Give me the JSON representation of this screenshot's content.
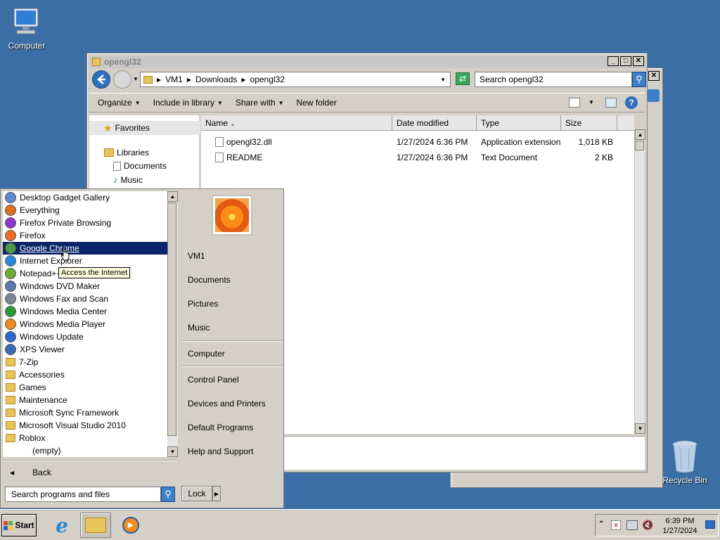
{
  "desktop": {
    "computer_label": "Computer",
    "recycle_label": "Recycle Bin"
  },
  "explorer": {
    "title": "opengl32",
    "breadcrumb": [
      "VM1",
      "Downloads",
      "opengl32"
    ],
    "search_placeholder": "Search opengl32",
    "commands": {
      "organize": "Organize",
      "include": "Include in library",
      "share": "Share with",
      "new_folder": "New folder"
    },
    "nav": {
      "favorites": "Favorites",
      "libraries": "Libraries",
      "documents": "Documents",
      "music": "Music"
    },
    "columns": [
      "Name",
      "Date modified",
      "Type",
      "Size"
    ],
    "files": [
      {
        "name": "opengl32.dll",
        "date": "1/27/2024 6:36 PM",
        "type": "Application extension",
        "size": "1,018 KB"
      },
      {
        "name": "README",
        "date": "1/27/2024 6:36 PM",
        "type": "Text Document",
        "size": "2 KB"
      }
    ]
  },
  "start_menu": {
    "programs": [
      {
        "label": "Desktop Gadget Gallery",
        "icon": "gadget-icon"
      },
      {
        "label": "Everything",
        "icon": "everything-icon"
      },
      {
        "label": "Firefox Private Browsing",
        "icon": "firefox-private-icon"
      },
      {
        "label": "Firefox",
        "icon": "firefox-icon"
      },
      {
        "label": "Google Chrome",
        "icon": "chrome-icon"
      },
      {
        "label": "Internet Explorer",
        "icon": "ie-icon"
      },
      {
        "label": "Notepad++",
        "icon": "notepadpp-icon"
      },
      {
        "label": "Windows DVD Maker",
        "icon": "dvd-maker-icon"
      },
      {
        "label": "Windows Fax and Scan",
        "icon": "fax-icon"
      },
      {
        "label": "Windows Media Center",
        "icon": "media-center-icon"
      },
      {
        "label": "Windows Media Player",
        "icon": "media-player-icon"
      },
      {
        "label": "Windows Update",
        "icon": "update-icon"
      },
      {
        "label": "XPS Viewer",
        "icon": "xps-icon"
      },
      {
        "label": "7-Zip",
        "icon": "folder-icon"
      },
      {
        "label": "Accessories",
        "icon": "folder-icon"
      },
      {
        "label": "Games",
        "icon": "folder-icon"
      },
      {
        "label": "Maintenance",
        "icon": "folder-icon"
      },
      {
        "label": "Microsoft Sync Framework",
        "icon": "folder-icon"
      },
      {
        "label": "Microsoft Visual Studio 2010",
        "icon": "folder-icon"
      },
      {
        "label": "Roblox",
        "icon": "folder-icon"
      }
    ],
    "empty_label": "(empty)",
    "back_label": "Back",
    "search_placeholder": "Search programs and files",
    "lock_label": "Lock",
    "tooltip": "Access the Internet",
    "right": {
      "user": "VM1",
      "documents": "Documents",
      "pictures": "Pictures",
      "music": "Music",
      "computer": "Computer",
      "control_panel": "Control Panel",
      "devices": "Devices and Printers",
      "default_programs": "Default Programs",
      "help": "Help and Support"
    }
  },
  "taskbar": {
    "start_label": "Start",
    "time": "6:39 PM",
    "date": "1/27/2024"
  }
}
